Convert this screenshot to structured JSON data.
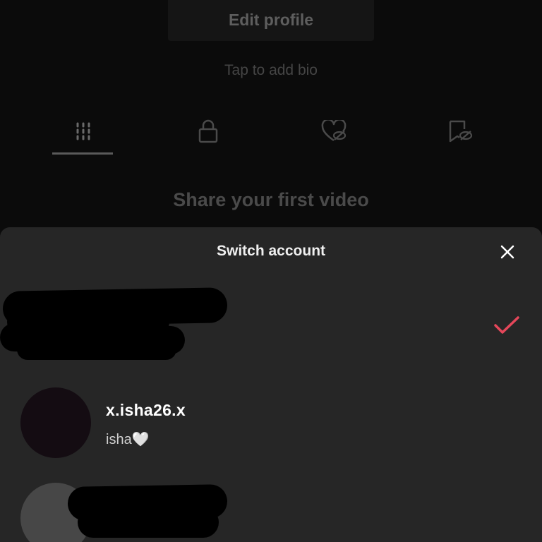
{
  "profile": {
    "edit_profile_label": "Edit profile",
    "bio_placeholder": "Tap to add bio",
    "tabs": [
      {
        "name": "videos",
        "icon": "grid-icon",
        "active": true
      },
      {
        "name": "private",
        "icon": "lock-icon",
        "active": false
      },
      {
        "name": "liked",
        "icon": "heart-hidden-icon",
        "active": false
      },
      {
        "name": "favorites",
        "icon": "bookmark-hidden-icon",
        "active": false
      }
    ],
    "empty_state": "Share your first video"
  },
  "switch_account": {
    "title": "Switch account",
    "close_icon": "close-icon",
    "accounts": [
      {
        "username": "",
        "nickname": "",
        "redacted": true,
        "current": true,
        "check_color": "#e5475a"
      },
      {
        "username": "x.isha26.x",
        "nickname": "isha🤍",
        "redacted": false,
        "current": false,
        "avatar_color": "#140c12"
      },
      {
        "username": "",
        "nickname": "",
        "redacted": true,
        "current": false,
        "avatar_color": "#474747"
      }
    ]
  },
  "colors": {
    "background": "#0b0b0b",
    "sheet": "#262626",
    "accent_check": "#e5475a"
  }
}
